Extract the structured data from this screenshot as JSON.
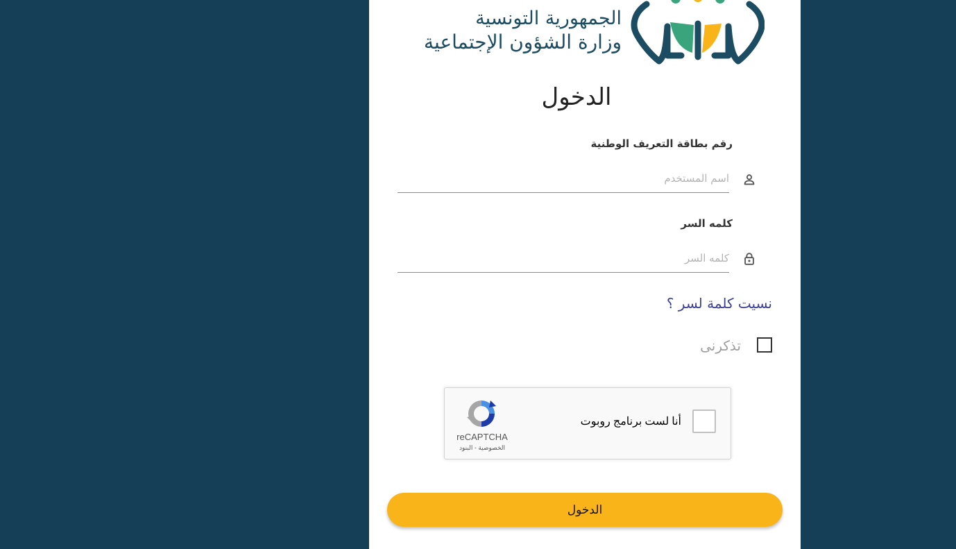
{
  "colors": {
    "page_background": "#153f56",
    "card_background": "#ffffff",
    "brand_dark": "#1b4c62",
    "brand_yellow": "#f8b418",
    "brand_green": "#3aa57d",
    "link": "#3a3f9a"
  },
  "header": {
    "ministry_line1": "الجمهورية التونسية",
    "ministry_line2": "وزارة الشؤون الإجتماعية",
    "logo_icon": "ministry-logo"
  },
  "form": {
    "title": "الدخول",
    "id_field": {
      "label": "رقم بطاقة التعريف الوطنية",
      "placeholder": "اسم المستخدم",
      "value": "",
      "icon": "person-icon"
    },
    "password_field": {
      "label": "كلمه السر",
      "placeholder": "كلمه السر",
      "value": "",
      "icon": "lock-icon"
    },
    "forgot_password": "نسيت كلمة لسر ؟",
    "remember_me": "تذكرنى",
    "remember_checked": false,
    "recaptcha": {
      "checkbox_label": "أنا لست برنامج روبوت",
      "brand": "reCAPTCHA",
      "links": "الخصوصية - البنود"
    },
    "submit_label": "الدخول"
  }
}
